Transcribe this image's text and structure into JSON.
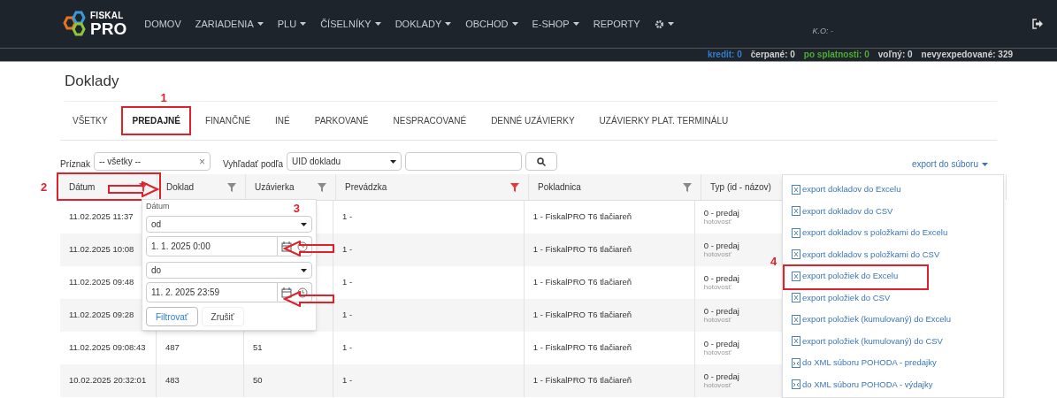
{
  "nav": {
    "logo": {
      "top": "FISKAL",
      "bottom": "PRO"
    },
    "items": [
      {
        "label": "DOMOV",
        "dropdown": false
      },
      {
        "label": "ZARIADENIA",
        "dropdown": true
      },
      {
        "label": "PLU",
        "dropdown": true
      },
      {
        "label": "ČÍSELNÍKY",
        "dropdown": true
      },
      {
        "label": "DOKLADY",
        "dropdown": true
      },
      {
        "label": "OBCHOD",
        "dropdown": true
      },
      {
        "label": "E-SHOP",
        "dropdown": true
      },
      {
        "label": "REPORTY",
        "dropdown": false
      }
    ],
    "user": "K.O: -"
  },
  "status": [
    {
      "label": "kredit: 0",
      "color": "#2f7fd0"
    },
    {
      "label": "čerpané: 0",
      "color": "#d0d0d0"
    },
    {
      "label": "po splatnosti: 0",
      "color": "#4cae2c"
    },
    {
      "label": "voľný: 0",
      "color": "#d0d0d0"
    },
    {
      "label": "nevyexpedované: 329",
      "color": "#d0d0d0"
    }
  ],
  "title": "Doklady",
  "tabs": [
    {
      "label": "VŠETKY",
      "selected": false
    },
    {
      "label": "PREDAJNÉ",
      "selected": true,
      "annotation": "1"
    },
    {
      "label": "FINANČNÉ",
      "selected": false
    },
    {
      "label": "INÉ",
      "selected": false
    },
    {
      "label": "PARKOVANÉ",
      "selected": false
    },
    {
      "label": "NESPRACOVANÉ",
      "selected": false
    },
    {
      "label": "DENNÉ UZÁVIERKY",
      "selected": false
    },
    {
      "label": "UZÁVIERKY PLAT. TERMINÁLU",
      "selected": false
    }
  ],
  "filter": {
    "flag_label": "Príznak",
    "flag_value": "-- všetky --",
    "clear_icon": "×",
    "search_label": "Vyhľadať podľa",
    "search_by": "UID dokladu"
  },
  "export_link": "export do súboru",
  "table": {
    "columns": [
      {
        "label": "Dátum",
        "filter_active": true,
        "annotation": "2"
      },
      {
        "label": "Doklad",
        "filter_active": false
      },
      {
        "label": "Uzávierka",
        "filter_active": false
      },
      {
        "label": "Prevádzka",
        "filter_active": true
      },
      {
        "label": "Pokladnica",
        "filter_active": false
      },
      {
        "label": "Typ (id - názov)"
      }
    ],
    "rows": [
      {
        "date": "11.02.2025 11:37",
        "receipt": "",
        "closing": "",
        "shop": "1 -",
        "register": "1 - FiskalPRO T6 tlačiareň",
        "type": "0 - predaj",
        "payment": "hotovosť"
      },
      {
        "date": "11.02.2025 10:08",
        "receipt": "",
        "closing": "",
        "shop": "1 -",
        "register": "1 - FiskalPRO T6 tlačiareň",
        "type": "0 - predaj",
        "payment": "hotovosť"
      },
      {
        "date": "11.02.2025 09:48",
        "receipt": "",
        "closing": "",
        "shop": "1 -",
        "register": "1 - FiskalPRO T6 tlačiareň",
        "type": "0 - predaj",
        "payment": "hotovosť"
      },
      {
        "date": "11.02.2025 09:28",
        "receipt": "",
        "closing": "",
        "shop": "1 -",
        "register": "1 - FiskalPRO T6 tlačiareň",
        "type": "0 - predaj",
        "payment": "hotovosť"
      },
      {
        "date": "11.02.2025 09:08:43",
        "receipt": "487",
        "closing": "51",
        "shop": "1 -",
        "register": "1 - FiskalPRO T6 tlačiareň",
        "type": "0 - predaj",
        "payment": "hotovosť"
      },
      {
        "date": "10.02.2025 20:32:01",
        "receipt": "483",
        "closing": "50",
        "shop": "1 -",
        "register": "1 - FiskalPRO T6 tlačiareň",
        "type": "0 - predaj",
        "payment": "hotovosť"
      }
    ]
  },
  "date_filter": {
    "title": "Dátum",
    "annotation": "3",
    "from_op": "od",
    "from_value": "1. 1. 2025 0:00",
    "to_op": "do",
    "to_value": "11. 2. 2025 23:59",
    "buttons": [
      {
        "label": "Filtrovať",
        "primary": true
      },
      {
        "label": "Zrušiť",
        "primary": false
      }
    ]
  },
  "export_menu": [
    {
      "label": "export dokladov do Excelu",
      "kind": "file"
    },
    {
      "label": "export dokladov do CSV",
      "kind": "file"
    },
    {
      "label": "export dokladov s položkami do Excelu",
      "kind": "file"
    },
    {
      "label": "export dokladov s položkami do CSV",
      "kind": "file"
    },
    {
      "label": "export položiek do Excelu",
      "kind": "file",
      "annotation": "4"
    },
    {
      "label": "export položiek do CSV",
      "kind": "file"
    },
    {
      "label": "export položiek (kumulovaný) do Excelu",
      "kind": "file"
    },
    {
      "label": "export položiek (kumulovaný) do CSV",
      "kind": "file"
    },
    {
      "label": "do XML súboru POHODA - predajky",
      "kind": "xml"
    },
    {
      "label": "do XML súboru POHODA - výdajky",
      "kind": "xml"
    }
  ]
}
